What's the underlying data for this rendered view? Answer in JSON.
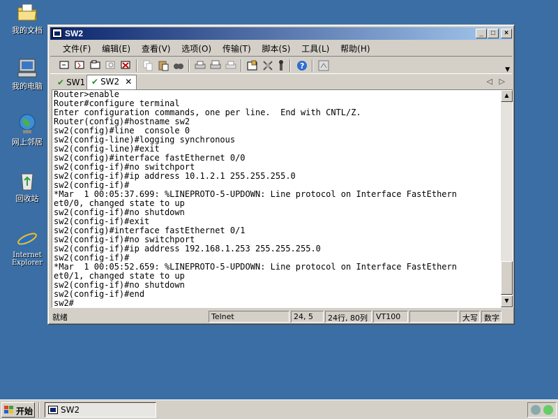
{
  "desktop": {
    "icons": [
      {
        "label": "我的文档",
        "icon": "my-documents-folder-icon"
      },
      {
        "label": "我的电脑",
        "icon": "my-computer-icon"
      },
      {
        "label": "网上邻居",
        "icon": "network-places-icon"
      },
      {
        "label": "回收站",
        "icon": "recycle-bin-icon"
      },
      {
        "label": "Internet\nExplorer",
        "icon": "internet-explorer-icon"
      }
    ]
  },
  "window": {
    "title": "SW2",
    "menu": [
      "文件(F)",
      "编辑(E)",
      "查看(V)",
      "选项(O)",
      "传输(T)",
      "脚本(S)",
      "工具(L)",
      "帮助(H)"
    ],
    "toolbar_icons": [
      "connect-icon",
      "quick-connect-icon",
      "connect-tab-icon",
      "reconnect-icon",
      "disconnect-icon",
      "copy-icon",
      "paste-icon",
      "find-icon",
      "print-icon",
      "print-screen-icon",
      "print-selection-icon",
      "session-options-icon",
      "global-options-icon",
      "keymap-icon",
      "help-icon",
      "sftp-icon"
    ],
    "tabs": [
      {
        "label": "SW1",
        "active": false
      },
      {
        "label": "SW2",
        "active": true
      }
    ],
    "terminal_lines": [
      "Router>enable",
      "Router#configure terminal",
      "Enter configuration commands, one per line.  End with CNTL/Z.",
      "Router(config)#hostname sw2",
      "sw2(config)#line  console 0",
      "sw2(config-line)#logging synchronous",
      "sw2(config-line)#exit",
      "sw2(config)#interface fastEthernet 0/0",
      "sw2(config-if)#no switchport",
      "sw2(config-if)#ip address 10.1.2.1 255.255.255.0",
      "sw2(config-if)#",
      "*Mar  1 00:05:37.699: %LINEPROTO-5-UPDOWN: Line protocol on Interface FastEthern",
      "et0/0, changed state to up",
      "sw2(config-if)#no shutdown",
      "sw2(config-if)#exit",
      "sw2(config)#interface fastEthernet 0/1",
      "sw2(config-if)#no switchport",
      "sw2(config-if)#ip address 192.168.1.253 255.255.255.0",
      "sw2(config-if)#",
      "*Mar  1 00:05:52.659: %LINEPROTO-5-UPDOWN: Line protocol on Interface FastEthern",
      "et0/1, changed state to up",
      "sw2(config-if)#no shutdown",
      "sw2(config-if)#end",
      "sw2#"
    ],
    "status": {
      "ready": "就绪",
      "protocol": "Telnet",
      "cursor": "24,  5",
      "size": "24行, 80列",
      "emulation": "VT100",
      "blank": "",
      "caps": "大写",
      "num": "数字"
    }
  },
  "taskbar": {
    "start_label": "开始",
    "task_label": "SW2"
  }
}
